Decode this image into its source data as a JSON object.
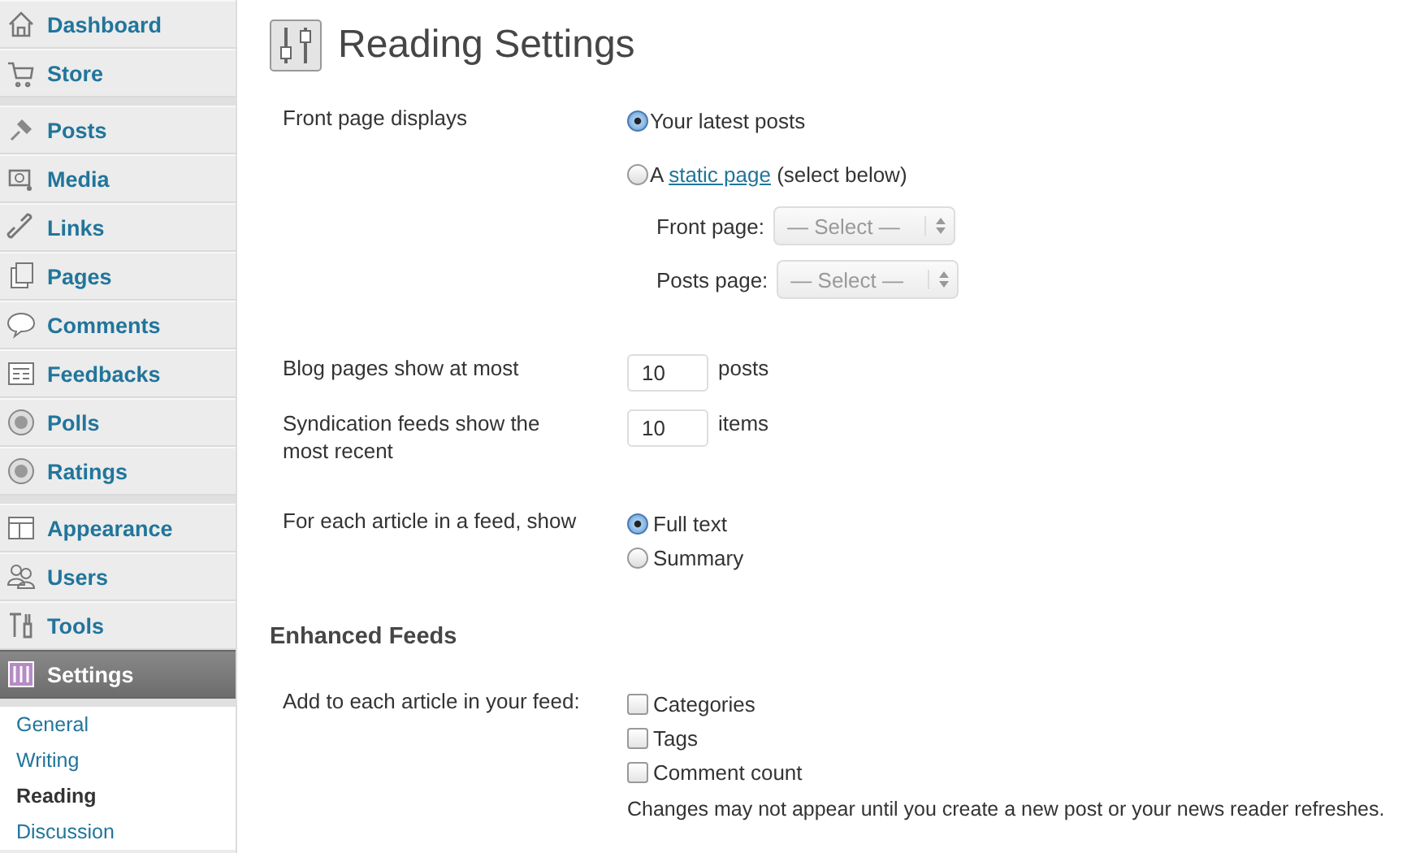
{
  "sidebar": {
    "groups": [
      {
        "items": [
          {
            "label": "Dashboard",
            "selected": false
          },
          {
            "label": "Store",
            "selected": false
          }
        ]
      },
      {
        "items": [
          {
            "label": "Posts",
            "selected": false
          },
          {
            "label": "Media",
            "selected": false
          },
          {
            "label": "Links",
            "selected": false
          },
          {
            "label": "Pages",
            "selected": false
          },
          {
            "label": "Comments",
            "selected": false
          },
          {
            "label": "Feedbacks",
            "selected": false
          },
          {
            "label": "Polls",
            "selected": false
          },
          {
            "label": "Ratings",
            "selected": false
          }
        ]
      },
      {
        "items": [
          {
            "label": "Appearance",
            "selected": false
          },
          {
            "label": "Users",
            "selected": false
          },
          {
            "label": "Tools",
            "selected": false
          },
          {
            "label": "Settings",
            "selected": true
          }
        ]
      }
    ],
    "submenu": [
      {
        "label": "General",
        "selected": false
      },
      {
        "label": "Writing",
        "selected": false
      },
      {
        "label": "Reading",
        "selected": true
      },
      {
        "label": "Discussion",
        "selected": false
      }
    ]
  },
  "page": {
    "title": "Reading Settings",
    "front_page": {
      "label": "Front page displays",
      "options": [
        {
          "text": "Your latest posts",
          "selected": true
        },
        {
          "text": "A",
          "link": "static page",
          "suffix": "(select below)",
          "selected": false
        }
      ],
      "selects": [
        {
          "label": "Front page:",
          "value": "— Select —",
          "disabled": true
        },
        {
          "label": "Posts page:",
          "value": "— Select —",
          "disabled": true
        }
      ]
    },
    "numbers": [
      {
        "label": "Blog pages show at most",
        "value": "10",
        "unit": "posts"
      },
      {
        "label": "Syndication feeds show the most recent",
        "value": "10",
        "unit": "items"
      }
    ],
    "feed_content": {
      "label": "For each article in a feed, show",
      "options": [
        {
          "text": "Full text",
          "selected": true
        },
        {
          "text": "Summary",
          "selected": false
        }
      ]
    },
    "enhanced_feeds": {
      "heading": "Enhanced Feeds",
      "label": "Add to each article in your feed:",
      "checks": [
        {
          "label": "Categories",
          "checked": false
        },
        {
          "label": "Tags",
          "checked": false
        },
        {
          "label": "Comment count",
          "checked": false
        }
      ],
      "note": "Changes may not appear until you create a new post or your news reader refreshes."
    }
  }
}
